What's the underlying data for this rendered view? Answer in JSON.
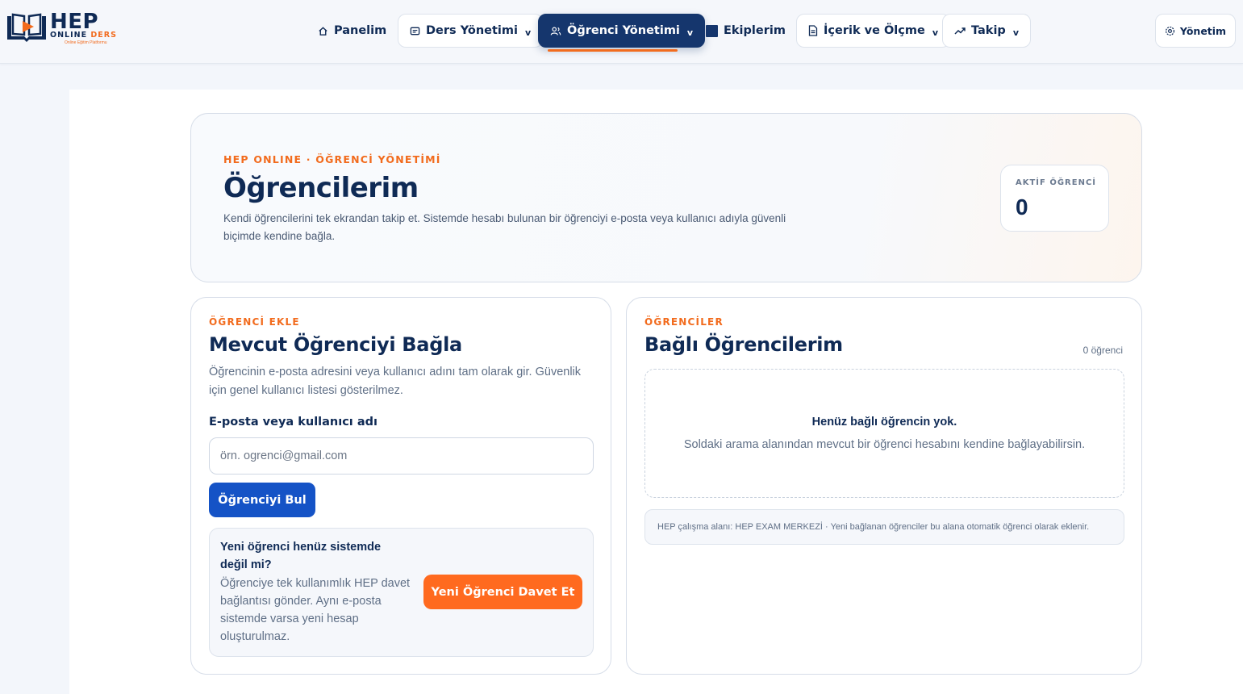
{
  "brand": {
    "name": "HEP",
    "sub_a": "ONLINE",
    "sub_b": "DERS",
    "tagline": "Online Eğitim Platformu"
  },
  "nav": {
    "items": [
      {
        "label": "Panelim",
        "icon": "home-icon"
      },
      {
        "label": "Ders Yönetimi",
        "icon": "book-icon",
        "chevron": "v"
      },
      {
        "label": "Öğrenci Yönetimi",
        "icon": "users-icon",
        "chevron": "v",
        "active": true
      },
      {
        "label": "Ekiplerim",
        "icon": "square-icon"
      },
      {
        "label": "İçerik ve Ölçme",
        "icon": "document-icon",
        "chevron": "v"
      },
      {
        "label": "Takip",
        "icon": "trend-icon",
        "chevron": "v"
      }
    ],
    "admin_label": "Yönetim"
  },
  "hero": {
    "eyebrow": "HEP ONLINE · ÖĞRENCİ YÖNETİMİ",
    "title": "Öğrencilerim",
    "description": "Kendi öğrencilerini tek ekrandan takip et. Sistemde hesabı bulunan bir öğrenciyi e-posta veya kullanıcı adıyla güvenli biçimde kendine bağla.",
    "stat_label": "AKTİF ÖĞRENCİ",
    "stat_value": "0"
  },
  "add_panel": {
    "eyebrow": "ÖĞRENCİ EKLE",
    "title": "Mevcut Öğrenciyi Bağla",
    "help": "Öğrencinin e-posta adresini veya kullanıcı adını tam olarak gir. Güvenlik için genel kullanıcı listesi gösterilmez.",
    "field_label": "E-posta veya kullanıcı adı",
    "field_placeholder": "örn. ogrenci@gmail.com",
    "field_value": "",
    "find_button": "Öğrenciyi Bul",
    "invite_question": "Yeni öğrenci henüz sistemde değil mi?",
    "invite_text": "Öğrenciye tek kullanımlık HEP davet bağlantısı gönder. Aynı e-posta sistemde varsa yeni hesap oluşturulmaz.",
    "invite_button": "Yeni Öğrenci Davet Et"
  },
  "list_panel": {
    "eyebrow": "ÖĞRENCİLER",
    "title": "Bağlı Öğrencilerim",
    "count": "0 öğrenci",
    "empty_title": "Henüz bağlı öğrencin yok.",
    "empty_text": "Soldaki arama alanından mevcut bir öğrenci hesabını kendine bağlayabilirsin.",
    "info": "HEP çalışma alanı: HEP EXAM MERKEZİ · Yeni bağlanan öğrenciler bu alana otomatik öğrenci olarak eklenir."
  },
  "colors": {
    "navy": "#0f2a55",
    "accent_orange": "#f26b1d",
    "active_nav": "#15366d",
    "primary_button": "#1553c6",
    "invite_button": "#ff6a1f"
  }
}
